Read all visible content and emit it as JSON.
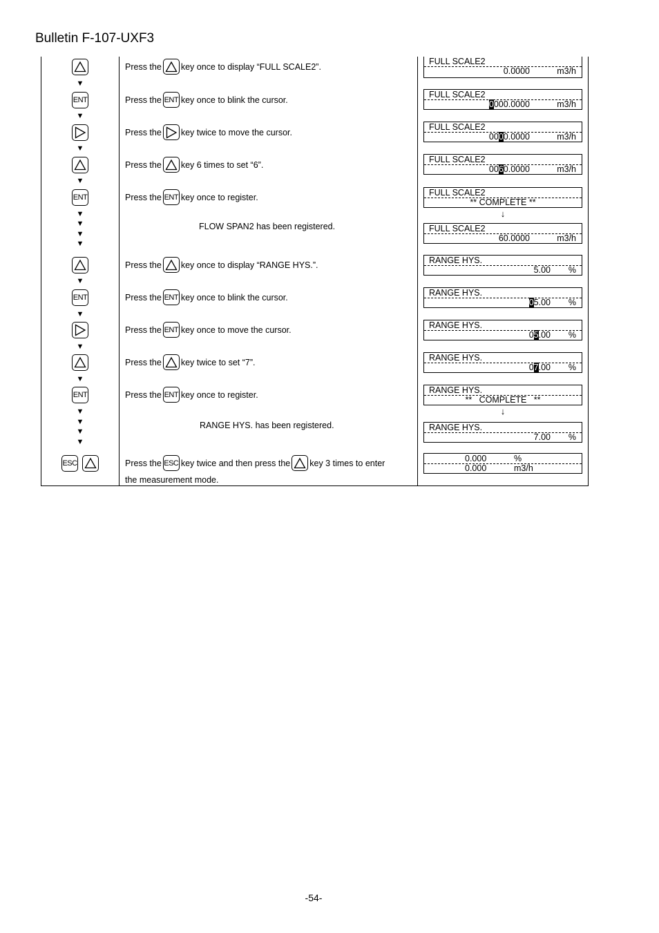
{
  "header": {
    "title": "Bulletin F-107-UXF3"
  },
  "footer": {
    "page_number": "-54-"
  },
  "steps": [
    {
      "keys": [
        "up"
      ],
      "text_before": "Press the",
      "text_key": "up",
      "text_after": "key once to display “FULL SCALE2”.",
      "display": {
        "line1": "FULL SCALE2",
        "value": "0.0000",
        "unit": "m3/h"
      }
    },
    {
      "keys": [
        "ENT"
      ],
      "text_before": "Press the",
      "text_key": "ENT",
      "text_after": "key once to blink the cursor.",
      "display": {
        "line1": "FULL SCALE2",
        "value_pre": "",
        "value_cursor": "0",
        "value_post": "000.0000",
        "unit": "m3/h"
      }
    },
    {
      "keys": [
        "right"
      ],
      "text_before": "Press the",
      "text_key": "right",
      "text_after": "key twice to move the cursor.",
      "display": {
        "line1": "FULL SCALE2",
        "value_pre": "00",
        "value_cursor": "0",
        "value_post": "0.0000",
        "unit": "m3/h"
      }
    },
    {
      "keys": [
        "up"
      ],
      "text_before": "Press the",
      "text_key": "up",
      "text_after": "key 6 times to set “6”.",
      "display": {
        "line1": "FULL SCALE2",
        "value_pre": "00",
        "value_cursor": "6",
        "value_post": "0.0000",
        "unit": "m3/h"
      }
    },
    {
      "keys": [
        "ENT"
      ],
      "text_before": "Press the",
      "text_key": "ENT",
      "text_after": "key once to register.",
      "display": {
        "line1": "FULL SCALE2",
        "message": "** COMPLETE **"
      }
    },
    {
      "message": "FLOW SPAN2 has been registered.",
      "display": {
        "line1": "FULL SCALE2",
        "value": "60.0000",
        "unit": "m3/h"
      }
    },
    {
      "keys": [
        "up"
      ],
      "text_before": "Press the",
      "text_key": "up",
      "text_after": "key once to display “RANGE HYS.”.",
      "display": {
        "line1": "RANGE HYS.",
        "value": "5.00",
        "unit": "%"
      }
    },
    {
      "keys": [
        "ENT"
      ],
      "text_before": "Press the",
      "text_key": "ENT",
      "text_after": "key once to blink the cursor.",
      "display": {
        "line1": "RANGE HYS.",
        "value_pre": "",
        "value_cursor": "0",
        "value_post": "5.00",
        "unit": "%"
      }
    },
    {
      "keys": [
        "right"
      ],
      "text_before": "Press the",
      "text_key": "ENT",
      "text_after": "key once to move the cursor.",
      "display": {
        "line1": "RANGE HYS.",
        "value_pre": "0",
        "value_cursor": "5",
        "value_post": ".00",
        "unit": "%"
      }
    },
    {
      "keys": [
        "up"
      ],
      "text_before": "Press the",
      "text_key": "up",
      "text_after": "key twice to set “7”.",
      "display": {
        "line1": "RANGE HYS.",
        "value_pre": "0",
        "value_cursor": "7",
        "value_post": ".00",
        "unit": "%"
      }
    },
    {
      "keys": [
        "ENT"
      ],
      "text_before": "Press the",
      "text_key": "ENT",
      "text_after": "key once to register.",
      "display": {
        "line1": "RANGE HYS.",
        "message": "**   COMPLETE   **"
      }
    },
    {
      "message": "RANGE HYS. has been registered.",
      "display": {
        "line1": "RANGE HYS.",
        "value": "7.00",
        "unit": "%"
      }
    },
    {
      "keys": [
        "ESC",
        "up"
      ],
      "text_before": "Press the",
      "text_key": "ESC",
      "text_mid": "key twice and then press the",
      "text_key2": "up",
      "text_after": "key 3 times to enter",
      "text_line2": "the measurement mode.",
      "display": {
        "line1_value": "0.000",
        "line1_unit": "%",
        "line2_value": "0.000",
        "line2_unit": "m3/h"
      }
    }
  ],
  "down_arrow": "↓",
  "flow_arrow": "▼",
  "key_labels": {
    "ENT": "ENT",
    "ESC": "ESC"
  }
}
